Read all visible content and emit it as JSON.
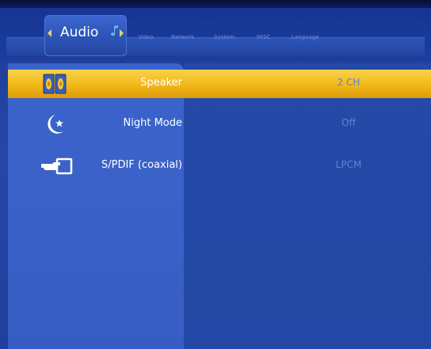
{
  "tabs": {
    "active": "Audio",
    "items": [
      "Video",
      "Network",
      "System",
      "MISC",
      "Language"
    ]
  },
  "settings": [
    {
      "label": "Speaker",
      "value": "2 CH",
      "icon": "speaker-icon",
      "selected": true
    },
    {
      "label": "Night Mode",
      "value": "Off",
      "icon": "moon-star-icon",
      "selected": false
    },
    {
      "label": "S/PDIF (coaxial)",
      "value": "LPCM",
      "icon": "pointing-hand-icon",
      "selected": false
    }
  ],
  "colors": {
    "background": "#2447a6",
    "sidebar": "#3a62c8",
    "highlight": "#f2b818",
    "value_text": "#5e83d4",
    "inactive_tab": "#6f8fd6"
  }
}
